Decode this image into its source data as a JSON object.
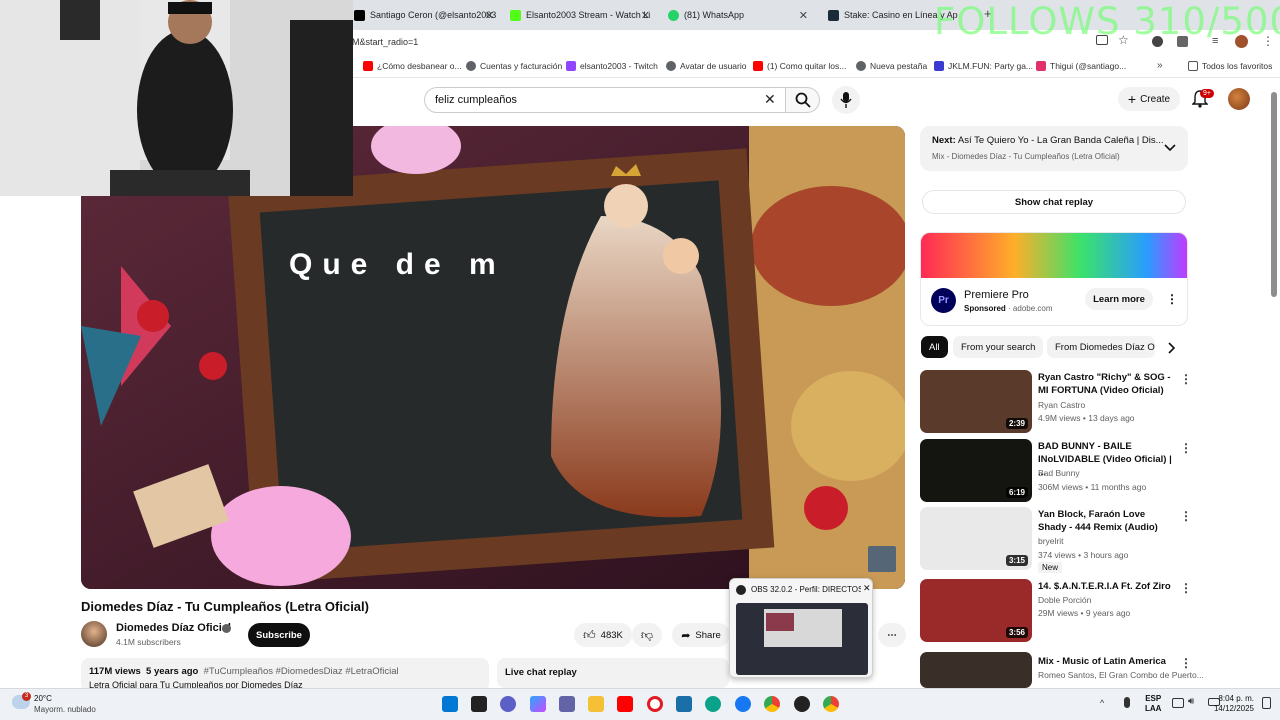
{
  "browser": {
    "tabs": [
      {
        "title": "Santiago Ceron (@elsanto2003",
        "color": "#000000"
      },
      {
        "title": "Elsanto2003 Stream - Watch Li",
        "color": "#53fc18"
      },
      {
        "title": "(81) WhatsApp",
        "color": "#25d366"
      },
      {
        "title": "Stake: Casino en Línea y Ap",
        "color": "#1a2c38"
      }
    ],
    "url": "M&start_radio=1",
    "bookmarks": [
      {
        "label": "¿Cómo desbanear o...",
        "color": "#ff0000"
      },
      {
        "label": "Cuentas y facturación",
        "color": "#5f6368"
      },
      {
        "label": "elsanto2003 - Twitch",
        "color": "#9146ff"
      },
      {
        "label": "Avatar de usuario",
        "color": "#5f6368"
      },
      {
        "label": "(1) Como quitar los...",
        "color": "#ff0000"
      },
      {
        "label": "Nueva pestaña",
        "color": "#5f6368"
      },
      {
        "label": "JKLM.FUN: Party ga...",
        "color": "#3b3bd1"
      },
      {
        "label": "Thigui (@santiago...",
        "color": "#e1306c"
      },
      {
        "label": "Todos los favoritos",
        "color": "#5f6368"
      }
    ]
  },
  "overlay": {
    "text": "FOLLOWS 310/500"
  },
  "header": {
    "search_value": "feliz cumpleaños",
    "create_label": "Create",
    "notif_count": "9+"
  },
  "video": {
    "lyric": "Que de m",
    "title": "Diomedes Díaz - Tu Cumpleaños (Letra Oficial)",
    "channel": "Diomedes Díaz Oficial",
    "subscribers": "4.1M subscribers",
    "subscribe_label": "Subscribe",
    "likes": "483K",
    "share_label": "Share",
    "views": "117M views",
    "age": "5 years ago",
    "hashtags": "#TuCumpleaños #DiomedesDiaz #LetraOficial",
    "description": "Letra Oficial para Tu Cumpleaños por Diomedes Díaz",
    "live_chat": "Live chat replay"
  },
  "sidebar": {
    "next_prefix": "Next:",
    "next_title": "Así Te Quiero Yo - La Gran Banda Caleña | Dis...",
    "next_sub": "Mix - Diomedes Díaz - Tu Cumpleaños (Letra Oficial)",
    "chat_replay": "Show chat replay",
    "ad": {
      "name": "Premiere Pro",
      "sponsored": "Sponsored",
      "domain": "adobe.com",
      "cta": "Learn more",
      "logo": "Pr"
    },
    "chips": [
      "All",
      "From your search",
      "From Diomedes Díaz Of"
    ],
    "videos": [
      {
        "title": "Ryan Castro \"Richy\" & SOG - MI FORTUNA (Video Oficial)",
        "channel": "Ryan Castro",
        "meta": "4.9M views • 13 days ago",
        "duration": "2:39",
        "badge": "",
        "thumb": "#5a3a2a"
      },
      {
        "title": "BAD BUNNY - BAILE INoLVIDABLE (Video Oficial) | ...",
        "channel": "Bad Bunny",
        "meta": "306M views • 11 months ago",
        "duration": "6:19",
        "badge": "",
        "thumb": "#141410"
      },
      {
        "title": "Yan Block, Faraón Love Shady - 444 Remix (Audio)",
        "channel": "bryelrit",
        "meta": "374 views • 3 hours ago",
        "duration": "3:15",
        "badge": "New",
        "thumb": "#e9e9e9"
      },
      {
        "title": "14. $.A.N.T.E.R.I.A Ft. Zof Ziro",
        "channel": "Doble Porción",
        "meta": "29M views • 9 years ago",
        "duration": "3:56",
        "badge": "",
        "thumb": "#9a2a2a"
      },
      {
        "title": "Mix - Music of Latin America",
        "channel": "",
        "meta": "Romeo Santos, El Gran Combo de Puerto...",
        "duration": "",
        "badge": "",
        "thumb": "#3a2f28"
      }
    ]
  },
  "obs": {
    "title": "OBS 32.0.2 - Perfil: DIRECTOS KI..."
  },
  "taskbar": {
    "weather_badge": "3",
    "temp": "20°C",
    "condition": "Mayorm. nublado",
    "lang1": "ESP",
    "lang2": "LAA",
    "time": "8:04 p. m.",
    "date": "14/12/2025"
  }
}
